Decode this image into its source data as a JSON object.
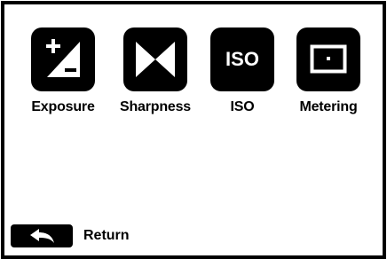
{
  "menu": {
    "items": [
      {
        "label": "Exposure",
        "icon": "exposure-icon"
      },
      {
        "label": "Sharpness",
        "icon": "sharpness-icon"
      },
      {
        "label": "ISO",
        "icon": "iso-icon",
        "icon_text": "ISO"
      },
      {
        "label": "Metering",
        "icon": "metering-icon"
      }
    ]
  },
  "footer": {
    "return_label": "Return",
    "return_icon": "back-arrow-icon"
  },
  "colors": {
    "foreground": "#000000",
    "background": "#ffffff"
  }
}
